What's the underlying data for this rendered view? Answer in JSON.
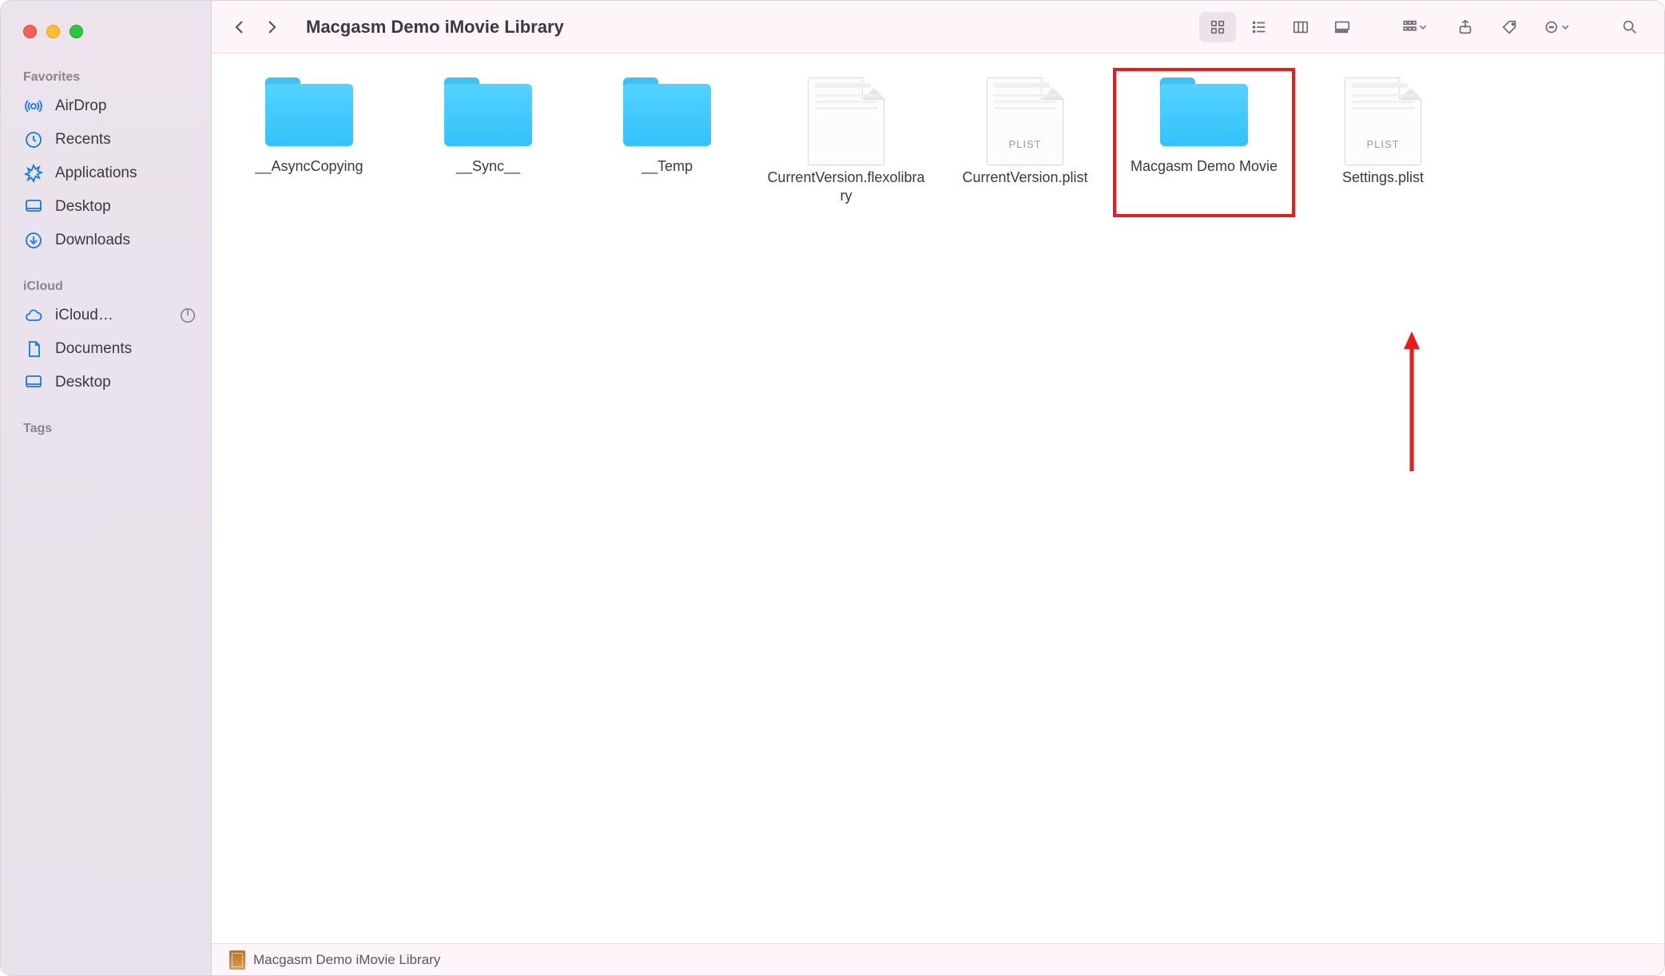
{
  "window": {
    "title": "Macgasm Demo iMovie Library"
  },
  "sidebar": {
    "sections": {
      "favorites_title": "Favorites",
      "icloud_title": "iCloud",
      "tags_title": "Tags"
    },
    "favorites": [
      {
        "label": "AirDrop"
      },
      {
        "label": "Recents"
      },
      {
        "label": "Applications"
      },
      {
        "label": "Desktop"
      },
      {
        "label": "Downloads"
      }
    ],
    "icloud": [
      {
        "label": "iCloud…",
        "has_progress": true
      },
      {
        "label": "Documents"
      },
      {
        "label": "Desktop"
      }
    ]
  },
  "items": [
    {
      "type": "folder",
      "label": "__AsyncCopying"
    },
    {
      "type": "folder",
      "label": "__Sync__"
    },
    {
      "type": "folder",
      "label": "__Temp"
    },
    {
      "type": "file",
      "label": "CurrentVersion.flexolibrary",
      "badge": ""
    },
    {
      "type": "file",
      "label": "CurrentVersion.plist",
      "badge": "PLIST"
    },
    {
      "type": "folder",
      "label": "Macgasm Demo Movie",
      "highlight": true
    },
    {
      "type": "file",
      "label": "Settings.plist",
      "badge": "PLIST"
    }
  ],
  "pathbar": {
    "label": "Macgasm Demo iMovie Library"
  },
  "colors": {
    "highlight": "#ec1b1b",
    "accent": "#1079e5"
  }
}
